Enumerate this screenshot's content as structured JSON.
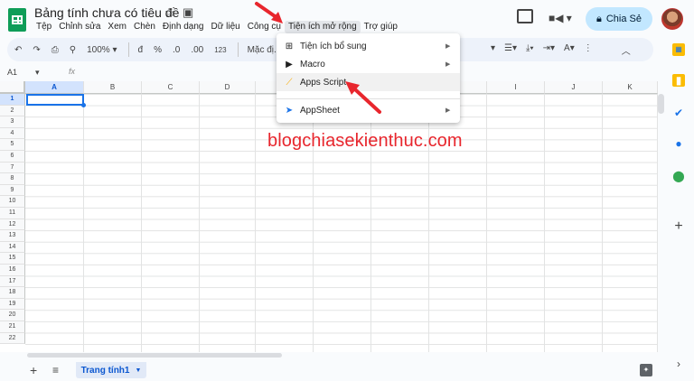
{
  "doc": {
    "title": "Bảng tính chưa có tiêu đề",
    "star_icon": "star-icon",
    "move_icon": "folder-icon",
    "cloud_icon": "cloud-icon"
  },
  "menubar": [
    "Tệp",
    "Chỉnh sửa",
    "Xem",
    "Chèn",
    "Định dạng",
    "Dữ liệu",
    "Công cụ",
    "Tiện ích mở rộng",
    "Trợ giúp"
  ],
  "header": {
    "share_label": "Chia Sẻ",
    "share_icon": "lock-icon",
    "comment_icon": "comment-icon",
    "meet_icon": "video-icon"
  },
  "toolbar": {
    "zoom": "100%",
    "currency": "đ",
    "percent": "%",
    "dec_decrease": ".0",
    "dec_increase": ".00",
    "number_format": "123",
    "font": "Mặc đị..."
  },
  "formula": {
    "namebox": "A1",
    "fx": "fx"
  },
  "columns": [
    "A",
    "B",
    "C",
    "D",
    "E",
    "F",
    "G",
    "H",
    "I",
    "J",
    "K"
  ],
  "rows": [
    "1",
    "2",
    "3",
    "4",
    "5",
    "6",
    "7",
    "8",
    "9",
    "10",
    "11",
    "12",
    "13",
    "14",
    "15",
    "16",
    "17",
    "18",
    "19",
    "20",
    "21",
    "22"
  ],
  "watermark": "blogchiasekienthuc.com",
  "menu": {
    "items": [
      {
        "label": "Tiện ích bổ sung",
        "icon": "addons-icon",
        "submenu": true
      },
      {
        "label": "Macro",
        "icon": "macro-icon",
        "submenu": true
      },
      {
        "label": "Apps Script",
        "icon": "apps-script-icon",
        "submenu": false
      },
      {
        "label": "AppSheet",
        "icon": "appsheet-icon",
        "submenu": true
      }
    ]
  },
  "sheets": {
    "active": "Trang tính1"
  },
  "colors": {
    "accent": "#0b57d0",
    "arrow": "#e8262d",
    "share_bg": "#c2e7ff",
    "sheets_green": "#0f9d58"
  }
}
